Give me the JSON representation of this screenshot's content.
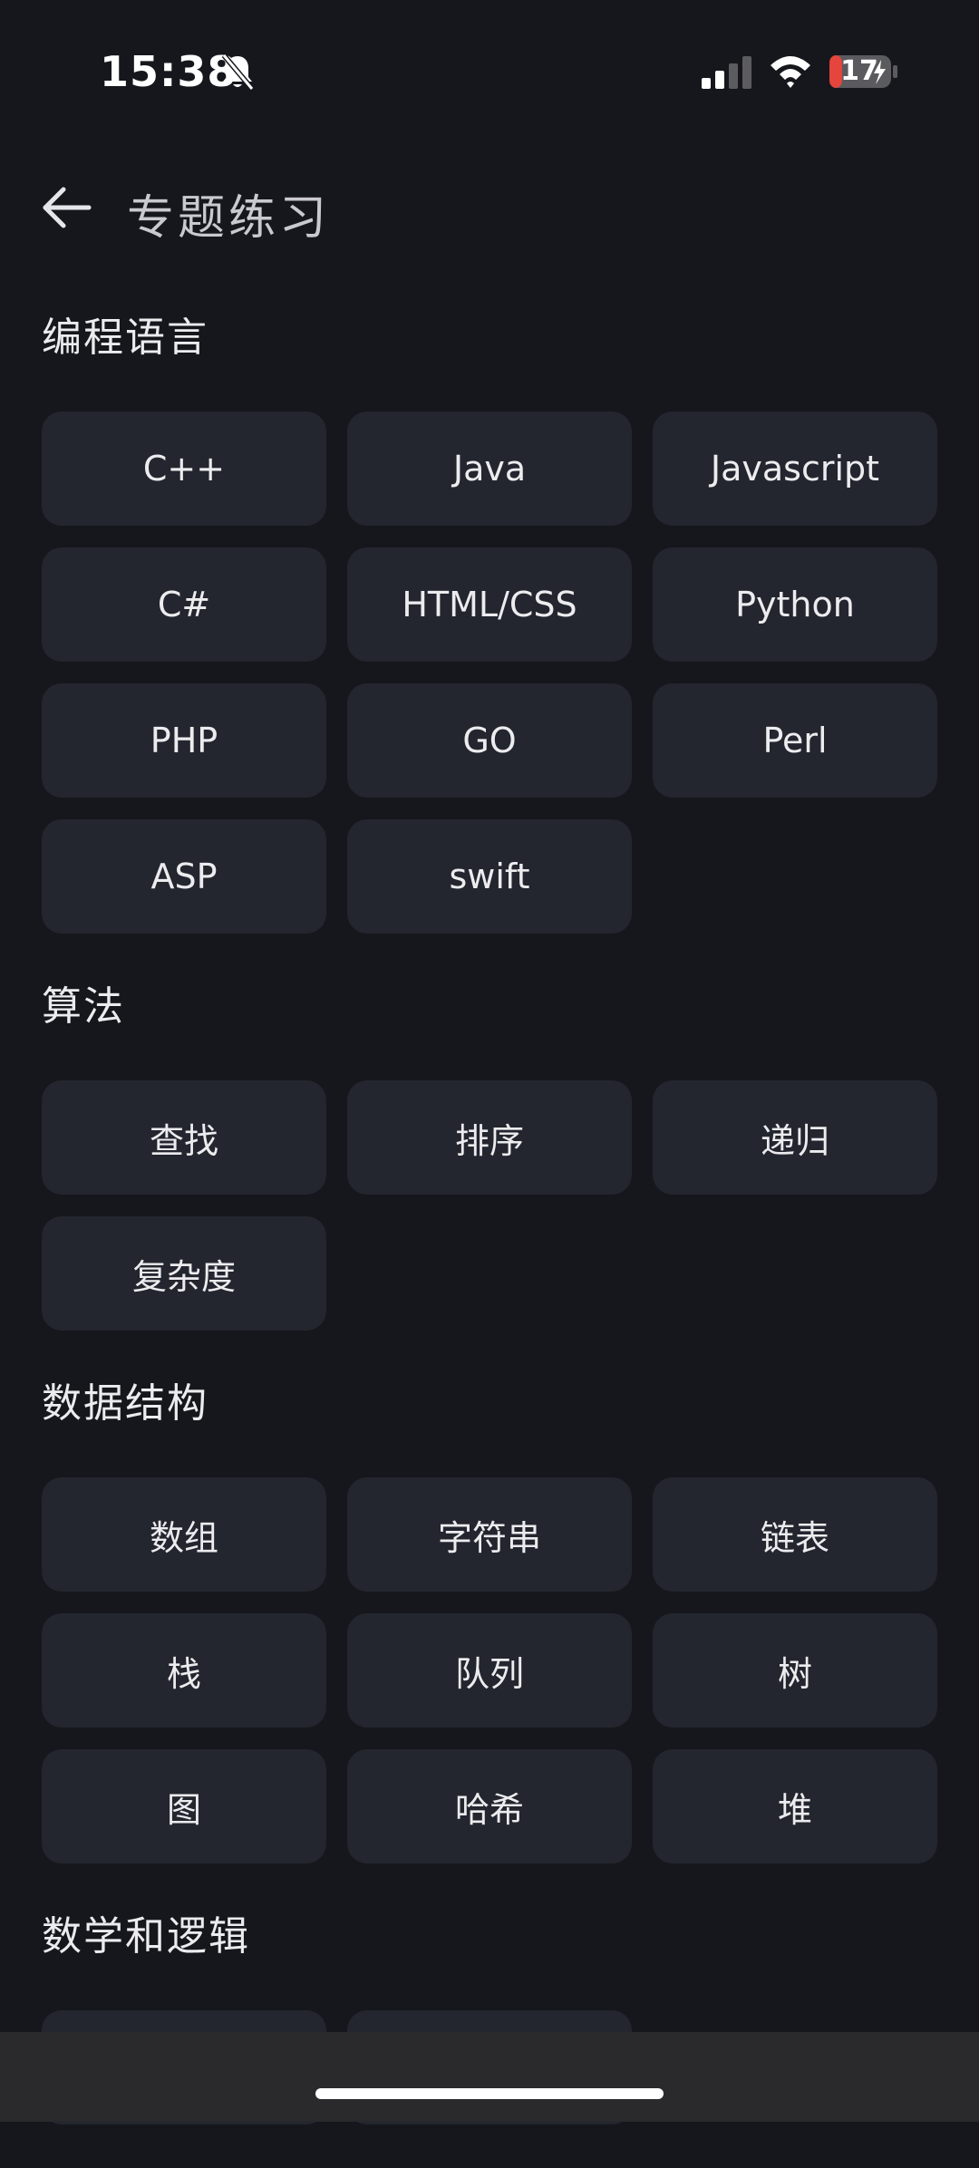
{
  "status_bar": {
    "time": "15:38",
    "battery": "17",
    "battery_color": "#e5453c",
    "icons": [
      "bell-slash-icon",
      "cellular-signal-icon",
      "wifi-icon",
      "battery-charging-icon"
    ]
  },
  "header": {
    "back_icon": "arrow-left-icon",
    "title": "专题练习"
  },
  "sections": [
    {
      "title": "编程语言",
      "items": [
        "C++",
        "Java",
        "Javascript",
        "C#",
        "HTML/CSS",
        "Python",
        "PHP",
        "GO",
        "Perl",
        "ASP",
        "swift"
      ]
    },
    {
      "title": "算法",
      "items": [
        "查找",
        "排序",
        "递归",
        "复杂度"
      ]
    },
    {
      "title": "数据结构",
      "items": [
        "数组",
        "字符串",
        "链表",
        "栈",
        "队列",
        "树",
        "图",
        "哈希",
        "堆"
      ]
    },
    {
      "title": "数学和逻辑",
      "items": [
        "",
        ""
      ]
    }
  ],
  "colors": {
    "background": "#16171c",
    "tile": "#23262f",
    "text": "#ececef"
  }
}
